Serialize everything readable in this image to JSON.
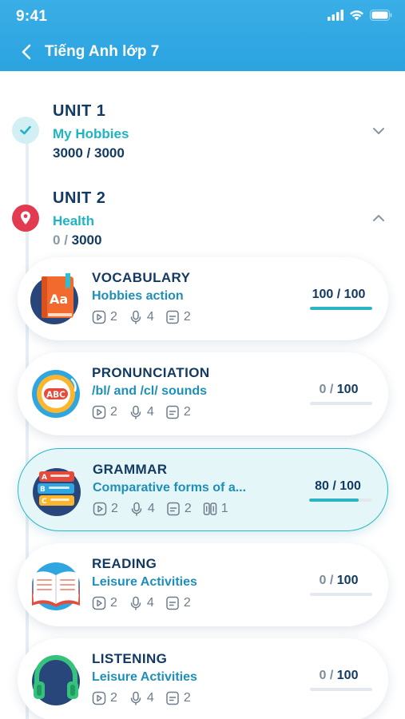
{
  "status": {
    "time": "9:41"
  },
  "header": {
    "title": "Tiếng Anh lớp 7"
  },
  "units": [
    {
      "title": "UNIT 1",
      "subtitle": "My Hobbies",
      "score": "3000",
      "max": "3000",
      "state": "completed"
    },
    {
      "title": "UNIT 2",
      "subtitle": "Health",
      "score": "0",
      "max": "3000",
      "state": "current"
    }
  ],
  "sep": " / ",
  "lessons": [
    {
      "title": "VOCABULARY",
      "subtitle": "Hobbies action",
      "videos": "2",
      "audio": "4",
      "docs": "2",
      "score": "100",
      "max": "100",
      "progress": 1.0,
      "icon": "vocabulary-book-icon"
    },
    {
      "title": "PRONUNCIATION",
      "subtitle": "/bl/ and /cl/ sounds",
      "videos": "2",
      "audio": "4",
      "docs": "2",
      "score": "0",
      "max": "100",
      "progress": 0,
      "icon": "pronunciation-abc-icon"
    },
    {
      "title": "GRAMMAR",
      "subtitle": "Comparative forms of a...",
      "videos": "2",
      "audio": "4",
      "docs": "2",
      "extra": "1",
      "score": "80",
      "max": "100",
      "progress": 0.8,
      "icon": "grammar-cards-icon"
    },
    {
      "title": "READING",
      "subtitle": "Leisure Activities",
      "videos": "2",
      "audio": "4",
      "docs": "2",
      "score": "0",
      "max": "100",
      "progress": 0,
      "icon": "reading-open-book-icon"
    },
    {
      "title": "LISTENING",
      "subtitle": "Leisure Activities",
      "videos": "2",
      "audio": "4",
      "docs": "2",
      "score": "0",
      "max": "100",
      "progress": 0,
      "icon": "listening-headphones-icon"
    }
  ],
  "colors": {
    "header": "#35a9e3",
    "accent": "#2cb4c4",
    "navy": "#123a62",
    "marker_done": "#d2f0f3",
    "marker_current": "#e23a51"
  }
}
